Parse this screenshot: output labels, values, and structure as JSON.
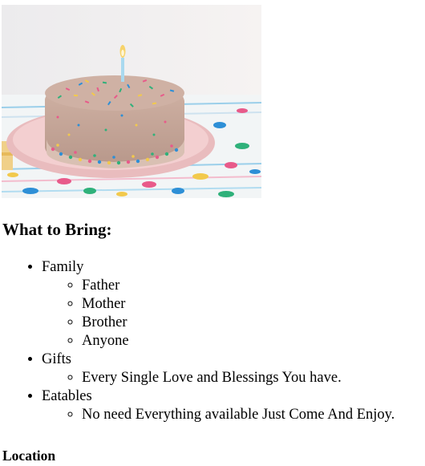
{
  "image": {
    "subject": "birthday cake with sprinkles and a lit candle",
    "colors": {
      "wall": "#f0eff0",
      "cake": "#c6a89a",
      "plate": "#efc7c8",
      "cloth": "#f1f4f4",
      "sprinkle_pink": "#e85a8a",
      "sprinkle_blue": "#2e8fd6",
      "sprinkle_green": "#2fb17a",
      "sprinkle_yellow": "#f2c94c"
    }
  },
  "section": {
    "heading": "What to Bring:",
    "items": [
      {
        "label": "Family",
        "children": [
          "Father",
          "Mother",
          "Brother",
          "Anyone"
        ]
      },
      {
        "label": "Gifts",
        "children": [
          "Every Single Love and Blessings You have."
        ]
      },
      {
        "label": "Eatables",
        "children": [
          "No need Everything available Just Come And Enjoy."
        ]
      }
    ]
  },
  "location": {
    "heading": "Location"
  }
}
